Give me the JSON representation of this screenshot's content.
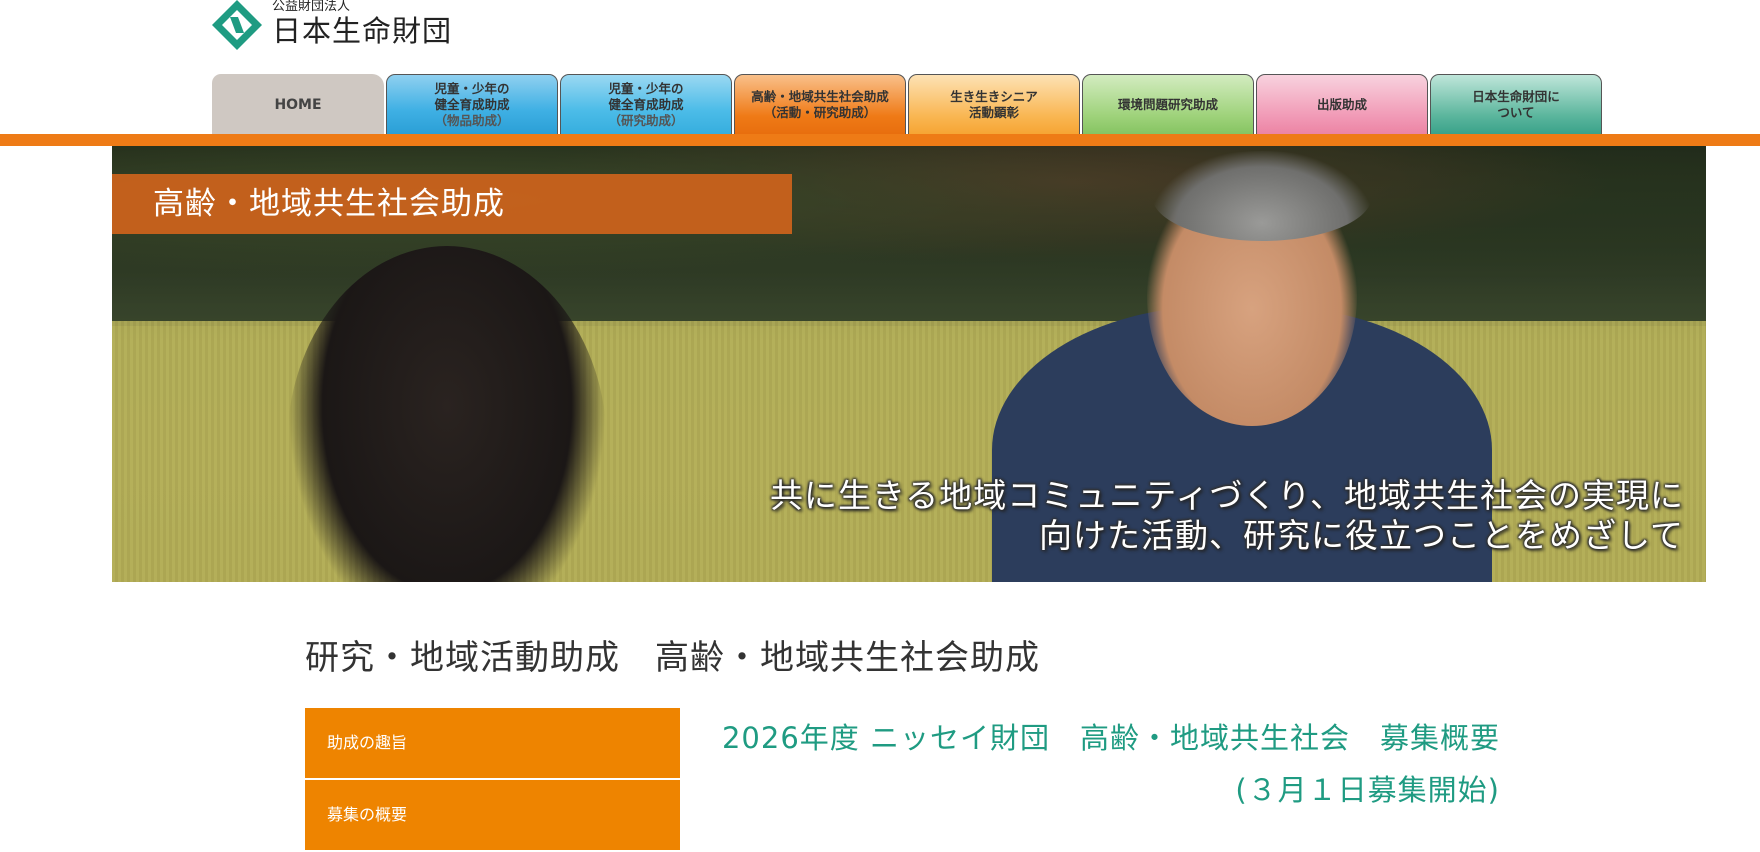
{
  "logo": {
    "sub": "公益財団法人",
    "main": "日本生命財団"
  },
  "nav": {
    "tabs": [
      {
        "line1": "HOME",
        "line2": "",
        "line3": "",
        "color": "#cfc8c2"
      },
      {
        "line1": "児童・少年の",
        "line2": "健全育成助成",
        "line3": "（物品助成）",
        "color": "#3fb0e4"
      },
      {
        "line1": "児童・少年の",
        "line2": "健全育成助成",
        "line3": "（研究助成）",
        "color": "#3fb0e4"
      },
      {
        "line1": "高齢・地域共生社会助成",
        "line2": "（活動・研究助成）",
        "line3": "",
        "color": "#ef7a16"
      },
      {
        "line1": "生き生きシニア",
        "line2": "活動顕彰",
        "line3": "",
        "color": "#f7a83a"
      },
      {
        "line1": "環境問題研究助成",
        "line2": "",
        "line3": "",
        "color": "#8cc865"
      },
      {
        "line1": "出版助成",
        "line2": "",
        "line3": "",
        "color": "#ee86a8"
      },
      {
        "line1": "日本生命財団に",
        "line2": "ついて",
        "line3": "",
        "color": "#3aa28a"
      }
    ]
  },
  "hero": {
    "label": "高齢・地域共生社会助成",
    "caption_line1": "共に生きる地域コミュニティづくり、地域共生社会の実現に",
    "caption_line2": "向けた活動、研究に役立つことをめざして"
  },
  "page_title": "研究・地域活動助成　高齢・地域共生社会助成",
  "side_menu": {
    "items": [
      "助成の趣旨",
      "募集の概要"
    ]
  },
  "recruit": {
    "line1": "2026年度 ニッセイ財団　高齢・地域共生社会　募集概要",
    "line2": "(３月１日募集開始)"
  },
  "colors": {
    "accent_orange": "#ee7b16",
    "menu_orange": "#ee8400",
    "teal_heading": "#1f9b82"
  }
}
